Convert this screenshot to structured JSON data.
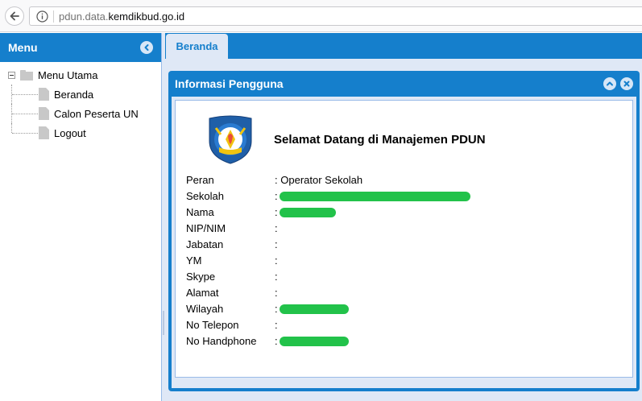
{
  "browser": {
    "url_prefix": "pdun.data.",
    "url_domain": "kemdikbud.go.id"
  },
  "menu": {
    "title": "Menu",
    "root": {
      "label": "Menu Utama"
    },
    "items": [
      {
        "label": "Beranda"
      },
      {
        "label": "Calon Peserta UN"
      },
      {
        "label": "Logout"
      }
    ]
  },
  "tabs": [
    {
      "label": "Beranda",
      "active": true
    }
  ],
  "panel": {
    "title": "Informasi Pengguna",
    "welcome": "Selamat Datang di Manajemen PDUN"
  },
  "user_info": {
    "sep": ":",
    "rows": [
      {
        "label": "Peran",
        "value": "Operator Sekolah",
        "redacted": false
      },
      {
        "label": "Sekolah",
        "value": "",
        "redacted": true
      },
      {
        "label": "Nama",
        "value": "",
        "redacted": true
      },
      {
        "label": "NIP/NIM",
        "value": "",
        "redacted": false
      },
      {
        "label": "Jabatan",
        "value": "",
        "redacted": false
      },
      {
        "label": "YM",
        "value": "",
        "redacted": false
      },
      {
        "label": "Skype",
        "value": "",
        "redacted": false
      },
      {
        "label": "Alamat",
        "value": "",
        "redacted": false
      },
      {
        "label": "Wilayah",
        "value": "",
        "redacted": true
      },
      {
        "label": "No Telepon",
        "value": "",
        "redacted": false
      },
      {
        "label": "No Handphone",
        "value": "",
        "redacted": true
      }
    ]
  },
  "colors": {
    "accent": "#157fcc",
    "background": "#dfe8f6",
    "redaction": "#22c24a"
  },
  "icons": {
    "back": "back-arrow-icon",
    "info": "info-icon",
    "collapse": "collapse-left-icon",
    "panel_collapse": "chevron-up-icon",
    "panel_close": "close-icon",
    "folder": "folder-icon",
    "file": "file-icon",
    "logo": "tut-wuri-handayani-logo"
  }
}
